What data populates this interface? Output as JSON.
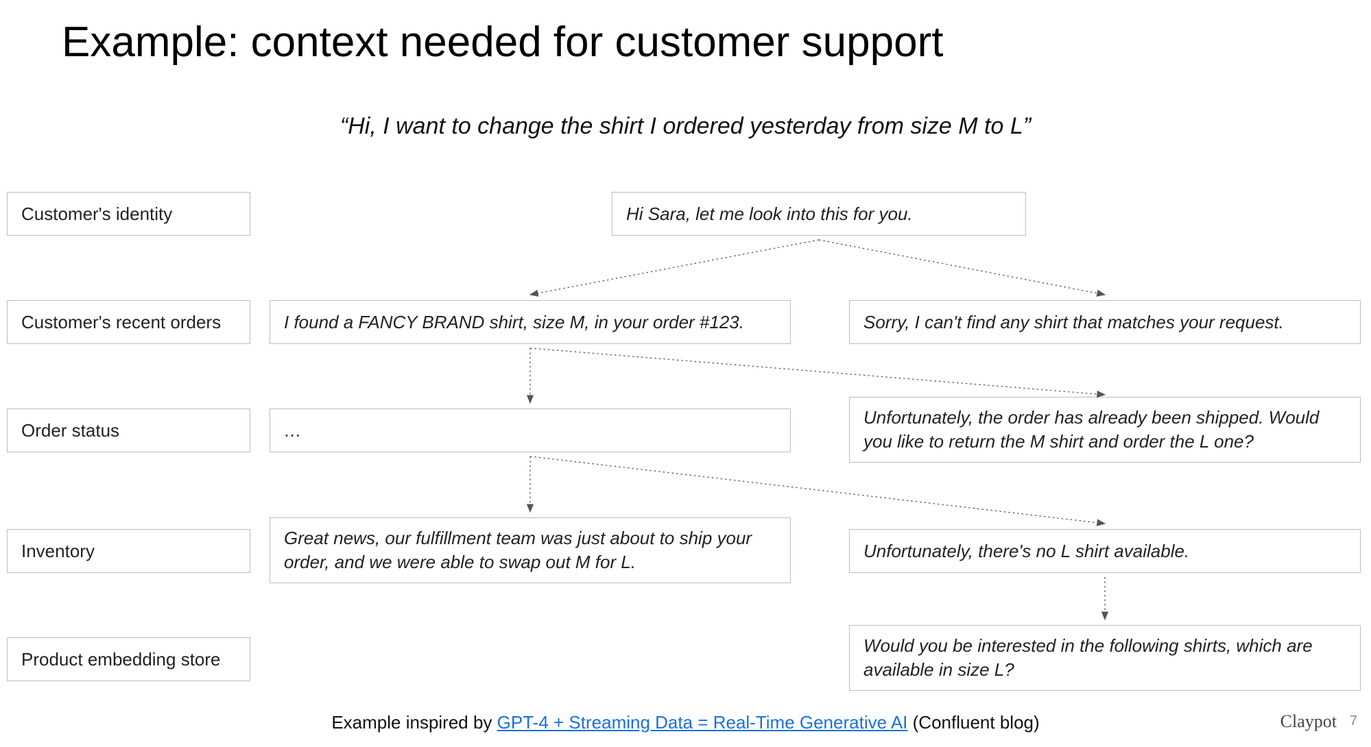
{
  "title": "Example: context needed for customer support",
  "quote": "“Hi, I want to change the shirt I ordered yesterday from size M to L”",
  "labels": {
    "identity": "Customer's identity",
    "recent_orders": "Customer's recent orders",
    "order_status": "Order status",
    "inventory": "Inventory",
    "embedding_store": "Product embedding store"
  },
  "responses": {
    "r0": "Hi Sara, let me look into this for you.",
    "r1_left": "I found a FANCY BRAND shirt, size M, in your order #123.",
    "r1_right": "Sorry, I can't find any shirt that matches your request.",
    "r2_left": "…",
    "r2_right": "Unfortunately, the order has already been shipped. Would you like to return the M shirt and order the L one?",
    "r3_left": "Great news, our fulfillment team was just about to ship your order, and we were able to swap out M for L.",
    "r3_right": "Unfortunately, there's no L shirt available.",
    "r4_right": "Would you be interested in the following shirts, which are available in size L?"
  },
  "footer": {
    "prefix": "Example inspired by ",
    "link_text": "GPT-4 + Streaming Data = Real-Time Generative AI",
    "suffix": " (Confluent blog)"
  },
  "brand": "Claypot",
  "page_number": "7"
}
